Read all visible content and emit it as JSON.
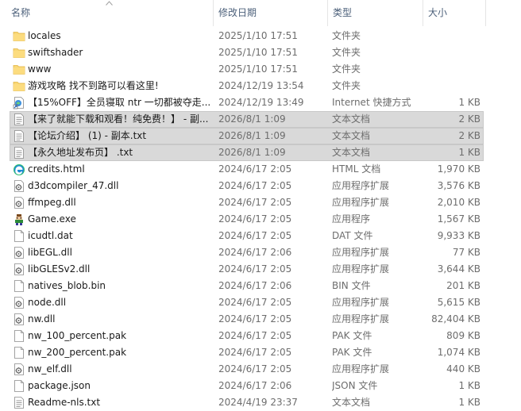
{
  "columns": {
    "name": "名称",
    "date": "修改日期",
    "type": "类型",
    "size": "大小"
  },
  "files": [
    {
      "name": "locales",
      "date": "2025/1/10 17:51",
      "type": "文件夹",
      "size": "",
      "icon": "folder-icon",
      "selected": false
    },
    {
      "name": "swiftshader",
      "date": "2025/1/10 17:51",
      "type": "文件夹",
      "size": "",
      "icon": "folder-icon",
      "selected": false
    },
    {
      "name": "www",
      "date": "2025/1/10 17:51",
      "type": "文件夹",
      "size": "",
      "icon": "folder-icon",
      "selected": false
    },
    {
      "name": "游戏攻略 找不到路可以看这里!",
      "date": "2024/12/19 13:54",
      "type": "文件夹",
      "size": "",
      "icon": "folder-icon",
      "selected": false
    },
    {
      "name": "【15%OFF】全员寝取 ntr 一切都被夺走...",
      "date": "2024/12/19 13:49",
      "type": "Internet 快捷方式",
      "size": "1 KB",
      "icon": "internet-shortcut-icon",
      "selected": false
    },
    {
      "name": "【来了就能下载和观看！纯免费！】 - 副...",
      "date": "2026/8/1 1:09",
      "type": "文本文档",
      "size": "2 KB",
      "icon": "text-file-icon",
      "selected": true
    },
    {
      "name": "【论坛介绍】 (1) - 副本.txt",
      "date": "2026/8/1 1:09",
      "type": "文本文档",
      "size": "2 KB",
      "icon": "text-file-icon",
      "selected": true
    },
    {
      "name": "【永久地址发布页】 .txt",
      "date": "2026/8/1 1:09",
      "type": "文本文档",
      "size": "1 KB",
      "icon": "text-file-icon",
      "selected": true
    },
    {
      "name": "credits.html",
      "date": "2024/6/17 2:05",
      "type": "HTML 文档",
      "size": "1,970 KB",
      "icon": "edge-html-icon",
      "selected": false
    },
    {
      "name": "d3dcompiler_47.dll",
      "date": "2024/6/17 2:05",
      "type": "应用程序扩展",
      "size": "3,576 KB",
      "icon": "dll-file-icon",
      "selected": false
    },
    {
      "name": "ffmpeg.dll",
      "date": "2024/6/17 2:05",
      "type": "应用程序扩展",
      "size": "2,010 KB",
      "icon": "dll-file-icon",
      "selected": false
    },
    {
      "name": "Game.exe",
      "date": "2024/6/17 2:05",
      "type": "应用程序",
      "size": "1,567 KB",
      "icon": "game-exe-icon",
      "selected": false
    },
    {
      "name": "icudtl.dat",
      "date": "2024/6/17 2:05",
      "type": "DAT 文件",
      "size": "9,933 KB",
      "icon": "blank-file-icon",
      "selected": false
    },
    {
      "name": "libEGL.dll",
      "date": "2024/6/17 2:06",
      "type": "应用程序扩展",
      "size": "77 KB",
      "icon": "dll-file-icon",
      "selected": false
    },
    {
      "name": "libGLESv2.dll",
      "date": "2024/6/17 2:05",
      "type": "应用程序扩展",
      "size": "3,644 KB",
      "icon": "dll-file-icon",
      "selected": false
    },
    {
      "name": "natives_blob.bin",
      "date": "2024/6/17 2:06",
      "type": "BIN 文件",
      "size": "201 KB",
      "icon": "blank-file-icon",
      "selected": false
    },
    {
      "name": "node.dll",
      "date": "2024/6/17 2:05",
      "type": "应用程序扩展",
      "size": "5,615 KB",
      "icon": "dll-file-icon",
      "selected": false
    },
    {
      "name": "nw.dll",
      "date": "2024/6/17 2:05",
      "type": "应用程序扩展",
      "size": "82,404 KB",
      "icon": "dll-file-icon",
      "selected": false
    },
    {
      "name": "nw_100_percent.pak",
      "date": "2024/6/17 2:05",
      "type": "PAK 文件",
      "size": "809 KB",
      "icon": "blank-file-icon",
      "selected": false
    },
    {
      "name": "nw_200_percent.pak",
      "date": "2024/6/17 2:05",
      "type": "PAK 文件",
      "size": "1,074 KB",
      "icon": "blank-file-icon",
      "selected": false
    },
    {
      "name": "nw_elf.dll",
      "date": "2024/6/17 2:05",
      "type": "应用程序扩展",
      "size": "440 KB",
      "icon": "dll-file-icon",
      "selected": false
    },
    {
      "name": "package.json",
      "date": "2024/6/17 2:06",
      "type": "JSON 文件",
      "size": "1 KB",
      "icon": "blank-file-icon",
      "selected": false
    },
    {
      "name": "Readme-nls.txt",
      "date": "2024/4/19 23:37",
      "type": "文本文档",
      "size": "1 KB",
      "icon": "text-file-icon",
      "selected": false
    }
  ],
  "colors": {
    "header_text": "#4c607a",
    "selection": "#d9d9d9",
    "folder": "#f8d775",
    "secondary_text": "#6d6d6d"
  }
}
